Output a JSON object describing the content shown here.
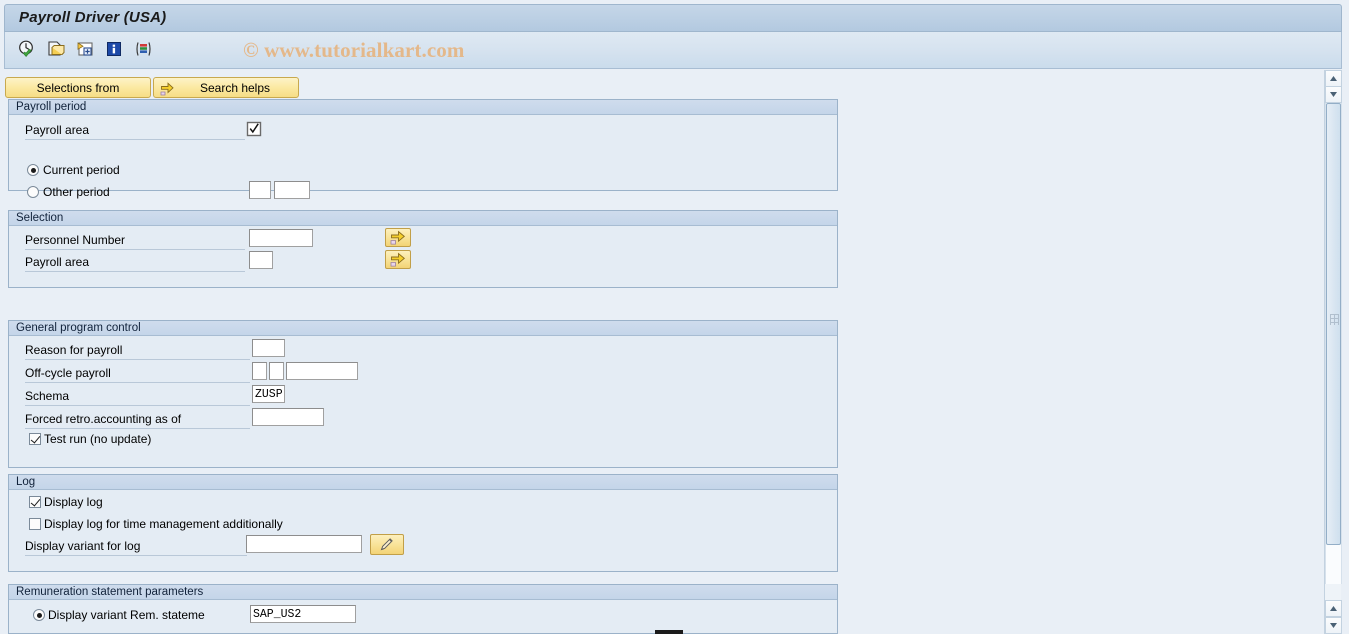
{
  "window": {
    "title": "Payroll Driver (USA)",
    "watermark": "© www.tutorialkart.com"
  },
  "toolbar": {
    "icons": [
      {
        "name": "execute-icon",
        "title": "Execute"
      },
      {
        "name": "execute-plus-icon",
        "title": "Execute + print"
      },
      {
        "name": "execute-background-icon",
        "title": "Execute in background"
      },
      {
        "name": "info-icon",
        "title": "Information"
      },
      {
        "name": "variant-icon",
        "title": "Get variant"
      }
    ]
  },
  "actions": {
    "selections_from": "Selections from",
    "search_helps": "Search helps"
  },
  "sections": {
    "payroll_period": {
      "header": "Payroll period",
      "payroll_area_label": "Payroll area",
      "current_period_label": "Current period",
      "other_period_label": "Other period",
      "current_period_selected": true,
      "other_period_1": "",
      "other_period_2": ""
    },
    "selection": {
      "header": "Selection",
      "personnel_number_label": "Personnel Number",
      "personnel_number_value": "",
      "payroll_area_label": "Payroll area",
      "payroll_area_value": ""
    },
    "general_program_control": {
      "header": "General program control",
      "reason_for_payroll_label": "Reason for payroll",
      "reason_for_payroll_value": "",
      "off_cycle_payroll_label": "Off-cycle payroll",
      "off_cycle_value_1": "",
      "off_cycle_value_2": "",
      "off_cycle_value_3": "",
      "schema_label": "Schema",
      "schema_value": "ZUSP",
      "forced_retro_label": "Forced retro.accounting as of",
      "forced_retro_value": "",
      "test_run_label": "Test run (no update)",
      "test_run_checked": true
    },
    "log": {
      "header": "Log",
      "display_log_label": "Display log",
      "display_log_checked": true,
      "display_log_time_label": "Display log for time management additionally",
      "display_log_time_checked": false,
      "display_variant_label": "Display variant for log",
      "display_variant_value": ""
    },
    "remuneration": {
      "header": "Remuneration statement parameters",
      "display_variant_rem_label": "Display variant Rem. stateme",
      "display_variant_rem_value": "SAP_US2",
      "display_variant_rem_selected": true
    }
  },
  "colors": {
    "page_background": "#e9eff6",
    "panel_background": "#e4ecf4",
    "panel_header": "#c4d5e9",
    "button_yellow": "#f8e296",
    "title_bar": "#bcd0e4",
    "watermark": "#e4b88a"
  }
}
